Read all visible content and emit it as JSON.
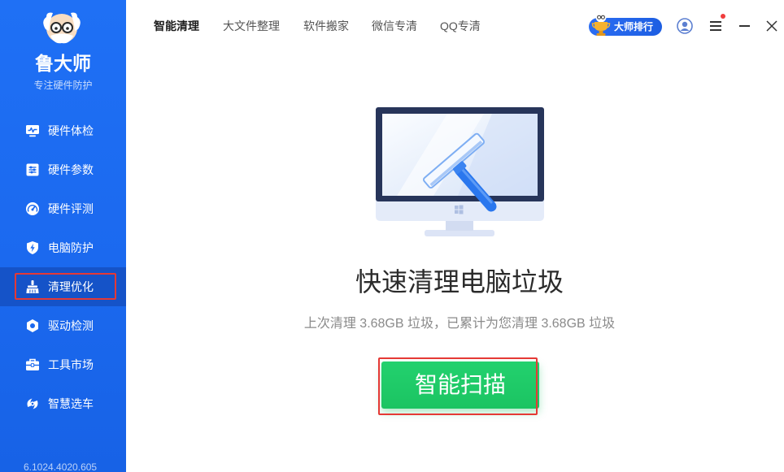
{
  "app": {
    "title": "鲁大师",
    "slogan": "专注硬件防护",
    "version": "6.1024.4020.605",
    "logo_icon": "lu-dashi-mascot-icon"
  },
  "sidebar": {
    "items": [
      {
        "label": "硬件体检",
        "icon": "monitor-pulse-icon",
        "active": false
      },
      {
        "label": "硬件参数",
        "icon": "parameter-list-icon",
        "active": false
      },
      {
        "label": "硬件评测",
        "icon": "speedometer-icon",
        "active": false
      },
      {
        "label": "电脑防护",
        "icon": "shield-bolt-icon",
        "active": false
      },
      {
        "label": "清理优化",
        "icon": "broom-icon",
        "active": true
      },
      {
        "label": "驱动检测",
        "icon": "driver-gear-icon",
        "active": false
      },
      {
        "label": "工具市场",
        "icon": "toolbox-icon",
        "active": false
      },
      {
        "label": "智慧选车",
        "icon": "smart-car-icon",
        "active": false
      }
    ]
  },
  "tabs": [
    {
      "label": "智能清理",
      "active": true
    },
    {
      "label": "大文件整理",
      "active": false
    },
    {
      "label": "软件搬家",
      "active": false
    },
    {
      "label": "微信专清",
      "active": false
    },
    {
      "label": "QQ专清",
      "active": false
    }
  ],
  "titlebar": {
    "rank_badge": "大师排行",
    "rank_icon": "trophy-icon",
    "has_notification": true
  },
  "main": {
    "title": "快速清理电脑垃圾",
    "summary": "上次清理 3.68GB 垃圾，已累计为您清理 3.68GB 垃圾",
    "scan_button": "智能扫描",
    "illustration": "monitor-squeegee-illustration"
  },
  "colors": {
    "sidebar_blue": "#1d6ef4",
    "sidebar_active": "#1553c8",
    "scan_green": "#1fcc68",
    "annotation_red": "#e53935",
    "notification_red": "#f03c3c"
  }
}
